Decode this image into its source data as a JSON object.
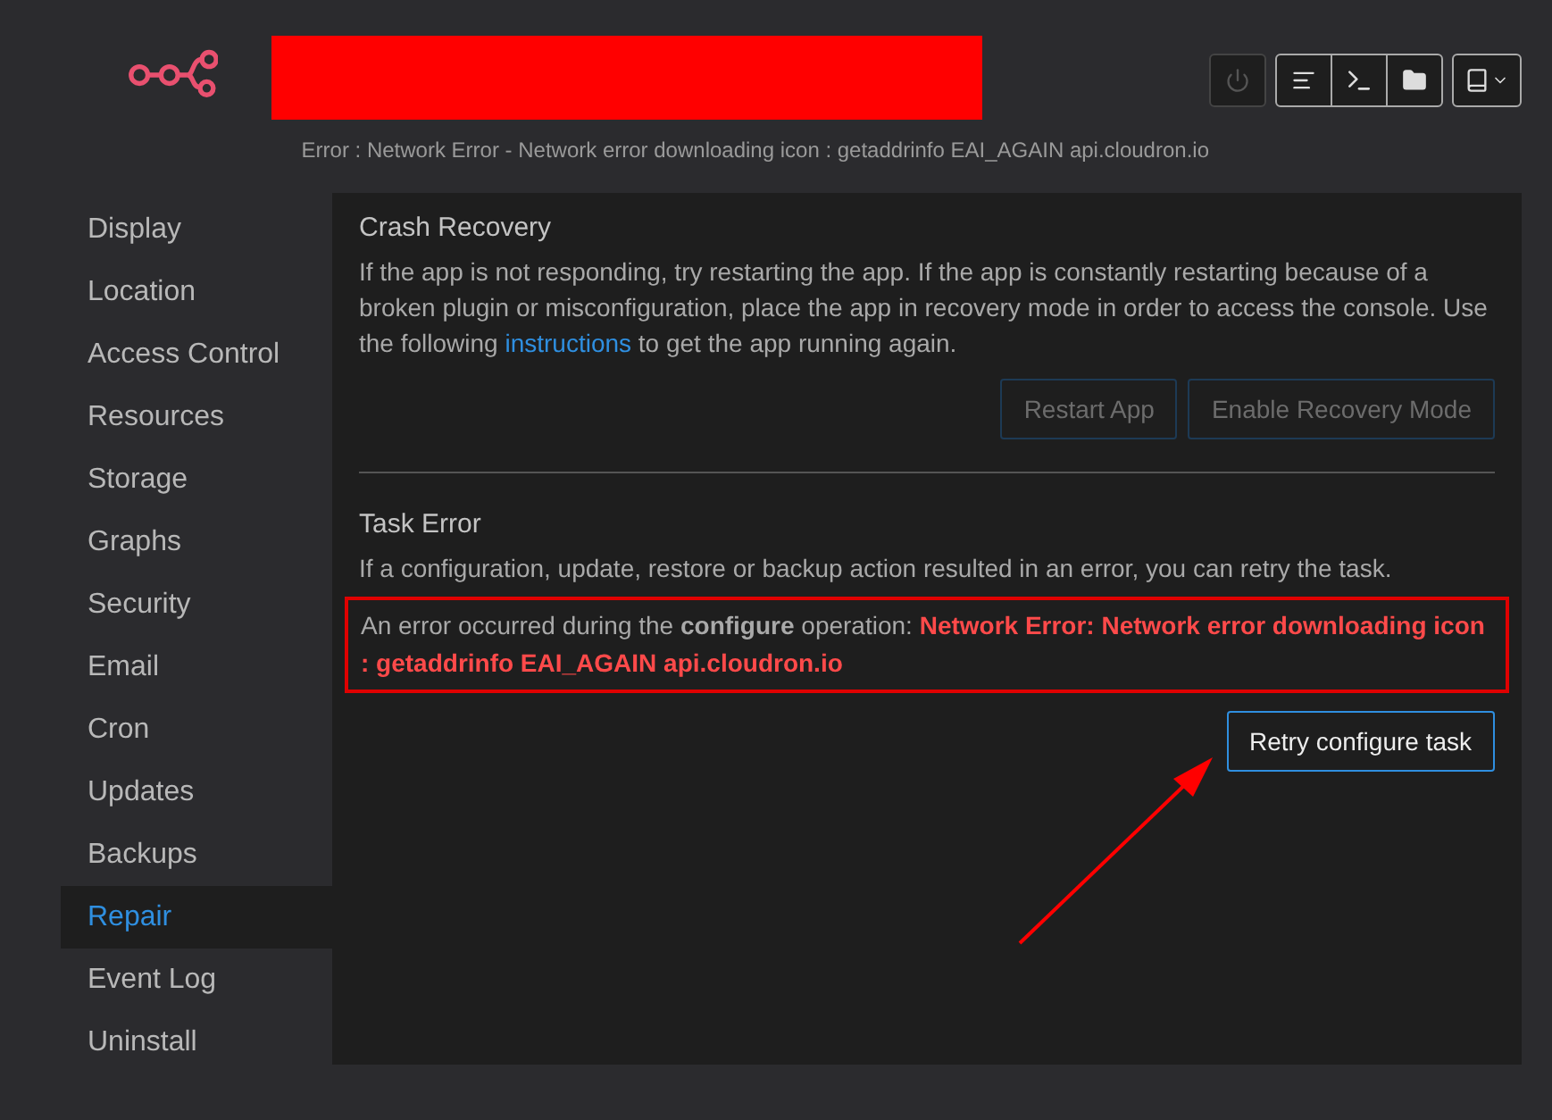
{
  "header": {
    "error": "Error : Network Error - Network error downloading icon : getaddrinfo EAI_AGAIN api.cloudron.io",
    "toolbar": [
      {
        "kind": "power",
        "disabled": true
      },
      {
        "kind": "logs",
        "disabled": false
      },
      {
        "kind": "terminal",
        "disabled": false
      },
      {
        "kind": "files",
        "disabled": false
      },
      {
        "kind": "docs",
        "disabled": false
      }
    ]
  },
  "sidebar": {
    "items": [
      {
        "label": "Display",
        "selected": false
      },
      {
        "label": "Location",
        "selected": false
      },
      {
        "label": "Access Control",
        "selected": false
      },
      {
        "label": "Resources",
        "selected": false
      },
      {
        "label": "Storage",
        "selected": false
      },
      {
        "label": "Graphs",
        "selected": false
      },
      {
        "label": "Security",
        "selected": false
      },
      {
        "label": "Email",
        "selected": false
      },
      {
        "label": "Cron",
        "selected": false
      },
      {
        "label": "Updates",
        "selected": false
      },
      {
        "label": "Backups",
        "selected": false
      },
      {
        "label": "Repair",
        "selected": true
      },
      {
        "label": "Event Log",
        "selected": false
      },
      {
        "label": "Uninstall",
        "selected": false
      }
    ]
  },
  "crash_recovery": {
    "title": "Crash Recovery",
    "text_before": "If the app is not responding, try restarting the app. If the app is constantly restarting because of a broken plugin or misconfiguration, place the app in recovery mode in order to access the console. Use the following",
    "link": "instructions",
    "text_after": "to get the app running again.",
    "buttons": [
      {
        "label": "Restart App",
        "disabled": true
      },
      {
        "label": "Enable Recovery Mode",
        "disabled": true
      }
    ]
  },
  "task_error": {
    "title": "Task Error",
    "description": "If a configuration, update, restore or backup action resulted in an error, you can retry the task.",
    "message": "An error occurred during the **configure** operation:",
    "error": "Network Error: Network error downloading icon : getaddrinfo EAI_AGAIN api.cloudron.io",
    "button": "Retry configure task"
  }
}
